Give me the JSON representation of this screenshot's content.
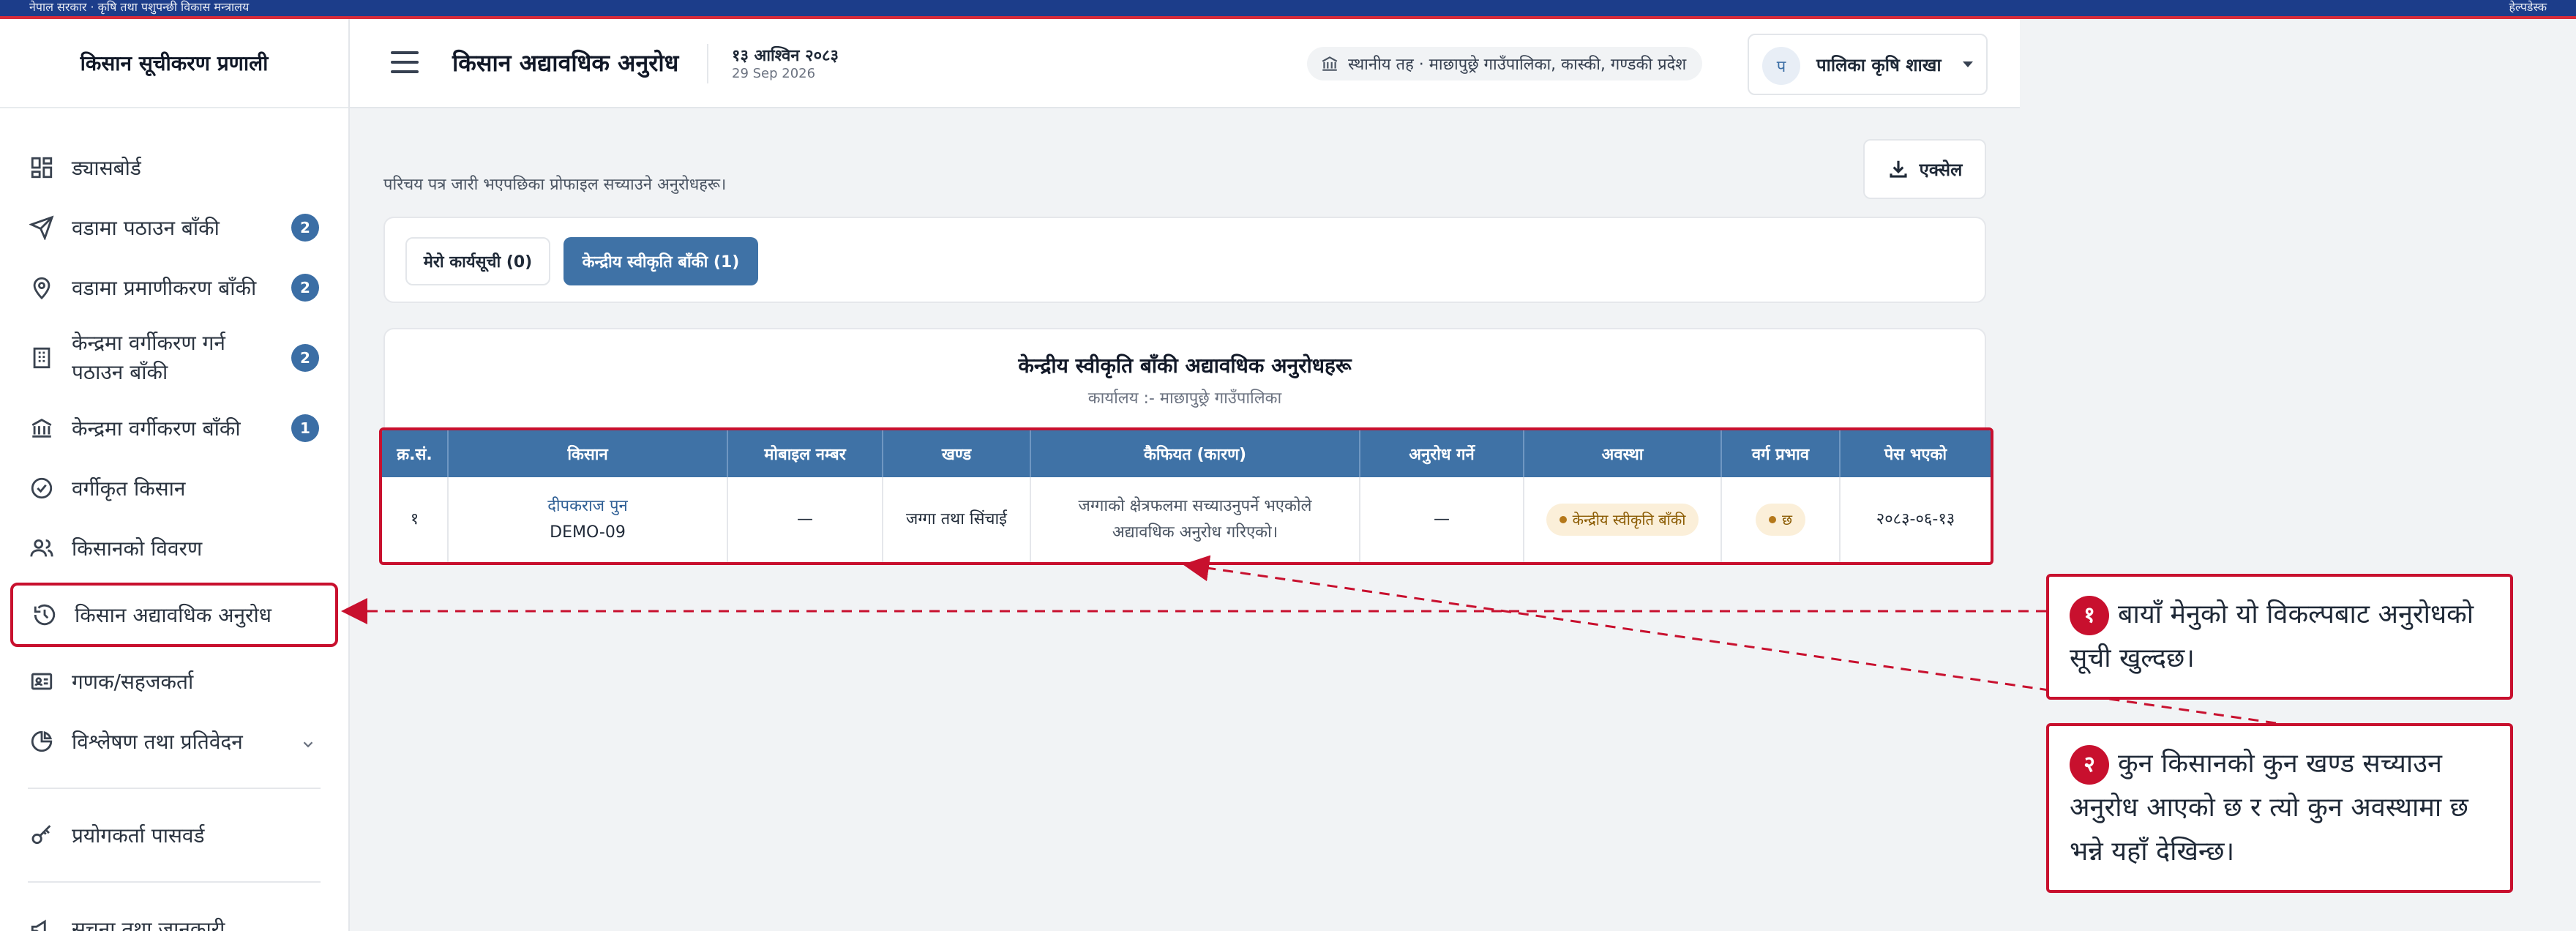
{
  "topbar": {
    "left_text": "नेपाल सरकार · कृषि तथा पशुपन्छी विकास मन्त्रालय",
    "right_text": "हेल्पडेस्क"
  },
  "app": {
    "brand": "किसान सूचीकरण प्रणाली"
  },
  "sidebar": {
    "items": [
      {
        "label": "ड्यासबोर्ड",
        "icon": "dashboard-icon"
      },
      {
        "label": "वडामा पठाउन बाँकी",
        "icon": "send-icon",
        "badge": "2"
      },
      {
        "label": "वडामा प्रमाणीकरण बाँकी",
        "icon": "map-pin-icon",
        "badge": "2"
      },
      {
        "label": "केन्द्रमा वर्गीकरण गर्न पठाउन बाँकी",
        "icon": "building-icon",
        "badge": "2"
      },
      {
        "label": "केन्द्रमा वर्गीकरण बाँकी",
        "icon": "bank-icon",
        "badge": "1"
      },
      {
        "label": "वर्गीकृत किसान",
        "icon": "check-circle-icon"
      },
      {
        "label": "किसानको विवरण",
        "icon": "users-icon"
      },
      {
        "label": "किसान अद्यावधिक अनुरोध",
        "icon": "history-icon"
      },
      {
        "label": "गणक/सहजकर्ता",
        "icon": "id-card-icon"
      },
      {
        "label": "विश्लेषण तथा प्रतिवेदन",
        "icon": "pie-chart-icon"
      },
      {
        "label": "प्रयोगकर्ता पासवर्ड",
        "icon": "key-icon"
      },
      {
        "label": "सूचना तथा जानकारी",
        "icon": "megaphone-icon"
      }
    ]
  },
  "header": {
    "title": "किसान अद्यावधिक अनुरोध",
    "date_ne": "१३ आश्विन २०८३",
    "date_en": "29 Sep 2026",
    "office": "स्थानीय तह · माछापुछ्रे गाउँपालिका, कास्की, गण्डकी प्रदेश",
    "user_initial": "प",
    "user_name": "पालिका कृषि शाखा"
  },
  "main": {
    "description": "परिचय पत्र जारी भएपछिका प्रोफाइल सच्याउने अनुरोधहरू।",
    "export_label": "एक्सेल",
    "tabs": [
      {
        "label": "मेरो कार्यसूची (0)"
      },
      {
        "label": "केन्द्रीय स्वीकृति बाँकी (1)"
      }
    ],
    "table": {
      "title": "केन्द्रीय स्वीकृति बाँकी अद्यावधिक अनुरोधहरू",
      "subtitle": "कार्यालय :- माछापुछ्रे गाउँपालिका",
      "headers": [
        "क्र.सं.",
        "किसान",
        "मोबाइल नम्बर",
        "खण्ड",
        "कैफियत (कारण)",
        "अनुरोध गर्ने",
        "अवस्था",
        "वर्ग प्रभाव",
        "पेस भएको"
      ],
      "rows": [
        {
          "sn": "१",
          "farmer_name": "दीपकराज पुन",
          "farmer_id": "DEMO-09",
          "mobile": "—",
          "section": "जग्गा तथा सिंचाई",
          "reason": "जग्गाको क्षेत्रफलमा सच्याउनुपर्ने भएकोले अद्यावधिक अनुरोध गरिएको।",
          "requester": "—",
          "status": "केन्द्रीय स्वीकृति बाँकी",
          "class_effect": "छ",
          "submitted": "२०८३-०६-१३"
        }
      ]
    }
  },
  "callouts": [
    {
      "number": "१",
      "text": "बायाँ मेनुको यो विकल्पबाट अनुरोधको सूची खुल्दछ।"
    },
    {
      "number": "२",
      "text": "कुन किसानको कुन खण्ड सच्याउन अनुरोध आएको छ र त्यो कुन अवस्थामा छ भन्ने यहाँ देखिन्छ।"
    }
  ],
  "colors": {
    "accent": "#3f72a6",
    "highlight": "#c8102e",
    "status_pill": "#fbefd9"
  }
}
